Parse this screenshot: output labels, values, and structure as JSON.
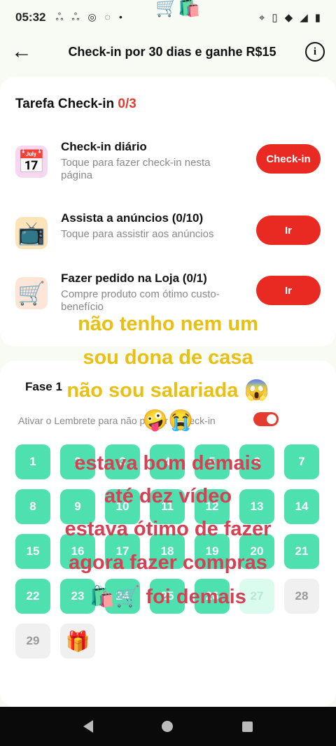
{
  "status": {
    "time": "05:32",
    "left_icons": [
      "notification-icon",
      "notification-icon",
      "instagram-icon",
      "whatsapp-icon",
      "dot-icon"
    ],
    "right_icons": [
      "location-icon",
      "vibrate-icon",
      "wifi-icon",
      "signal-icon",
      "battery-icon"
    ]
  },
  "header": {
    "title": "Check-in por 30 dias e ganhe R$15"
  },
  "tasks": {
    "title": "Tarefa Check-in",
    "count": "0/3",
    "items": [
      {
        "name": "Check-in diário",
        "desc": "Toque para fazer check-in nesta página",
        "button": "Check-in",
        "icon": "calendar-icon"
      },
      {
        "name": "Assista a anúncios  (0/10)",
        "desc": "Toque para assistir aos anúncios",
        "button": "Ir",
        "icon": "tv-ad-icon"
      },
      {
        "name": "Fazer pedido na Loja  (0/1)",
        "desc": "Compre produto com ótimo custo-benefício",
        "button": "Ir",
        "icon": "cart-icon"
      }
    ]
  },
  "phase": {
    "title": "Fase 1",
    "reminder": "Ativar o Lembrete para não perder o check-in",
    "reminder_on": true,
    "days": [
      "1",
      "2",
      "3",
      "4",
      "5",
      "6",
      "7",
      "8",
      "9",
      "10",
      "11",
      "12",
      "13",
      "14",
      "15",
      "16",
      "17",
      "18",
      "19",
      "20",
      "21",
      "22",
      "23",
      "24",
      "25",
      "26",
      "27",
      "28",
      "29"
    ]
  },
  "overlay_text": {
    "line1": "não tenho nem um",
    "line2": "sou dona de casa",
    "line3": "não sou salariada 😱",
    "line4": "🤪😭",
    "line5": "estava bom demais",
    "line6": "até dez vídeo",
    "line7": "estava ótimo de fazer",
    "line8": "agora fazer compras",
    "line9": "🛍️🛒 foi demais"
  },
  "colors": {
    "accent_red": "#e92a22",
    "day_green": "#4fe0b0",
    "overlay_yellow": "#e9c012",
    "overlay_red": "#d44155"
  }
}
